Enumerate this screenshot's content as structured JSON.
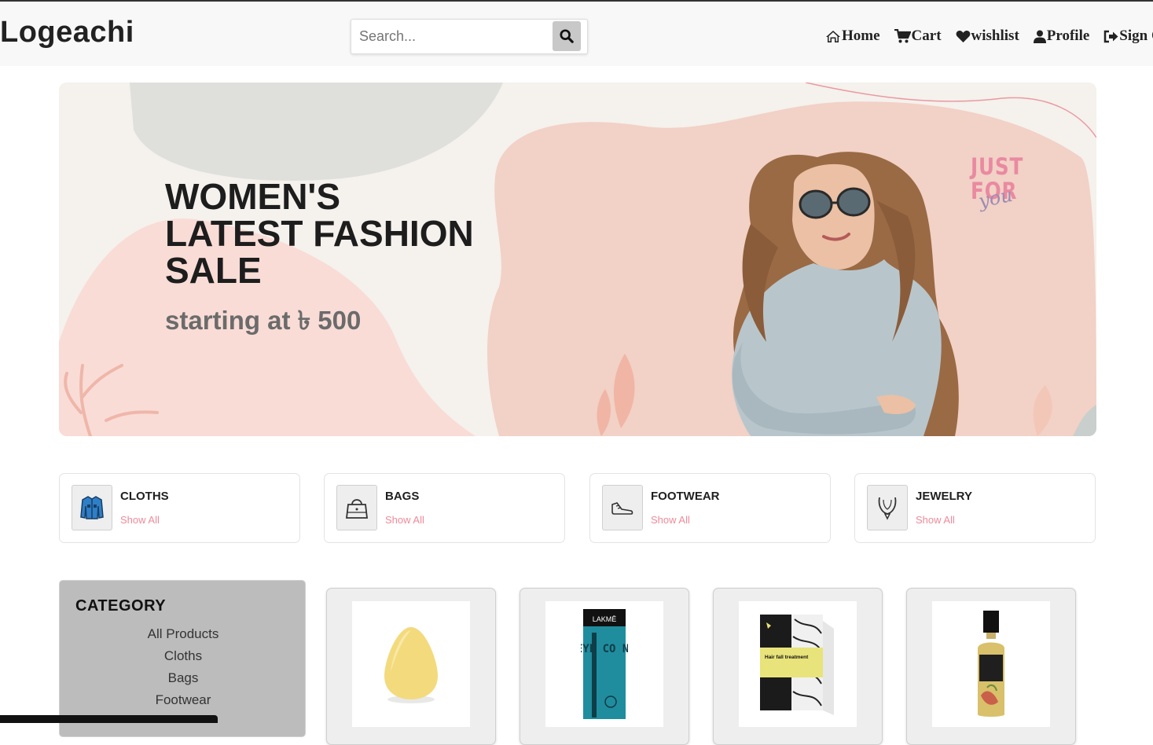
{
  "navbar": {
    "brand": "Logeachi",
    "search": {
      "placeholder": "Search..."
    },
    "links": [
      {
        "label": "Home",
        "icon": "home-icon"
      },
      {
        "label": "Cart",
        "icon": "cart-icon"
      },
      {
        "label": "wishlist",
        "icon": "heart-icon"
      },
      {
        "label": "Profile",
        "icon": "user-icon"
      },
      {
        "label": "Sign Ou",
        "icon": "sign-out-icon"
      }
    ]
  },
  "hero": {
    "title_line1": "WOMEN'S",
    "title_line2": "LATEST FASHION",
    "title_line3": "SALE",
    "subtitle": "starting at ৳ 500",
    "badge_top": "JUST",
    "badge_mid": "FOR",
    "badge_script": "you"
  },
  "categories": [
    {
      "name": "CLOTHS",
      "link": "Show All",
      "icon": "jacket-icon"
    },
    {
      "name": "BAGS",
      "link": "Show All",
      "icon": "handbag-icon"
    },
    {
      "name": "FOOTWEAR",
      "link": "Show All",
      "icon": "shoe-icon"
    },
    {
      "name": "JEWELRY",
      "link": "Show All",
      "icon": "necklace-icon"
    }
  ],
  "sidebar": {
    "title": "CATEGORY",
    "items": [
      "All Products",
      "Cloths",
      "Bags",
      "Footwear"
    ]
  },
  "products": [
    {
      "image": "makeup-sponge-image"
    },
    {
      "image": "lakme-eyeconic-kajal-image",
      "brand_text": "LAKMĒ",
      "product_text": "EYE CO NIC"
    },
    {
      "image": "hair-fall-treatment-box-image",
      "product_text": "Hair fall treatment"
    },
    {
      "image": "hair-oil-bottle-image"
    }
  ],
  "colors": {
    "accent_pink": "#ef8a9a",
    "navbar_bg": "#f8f8f8",
    "sidebar_bg": "#bcbcbc"
  }
}
